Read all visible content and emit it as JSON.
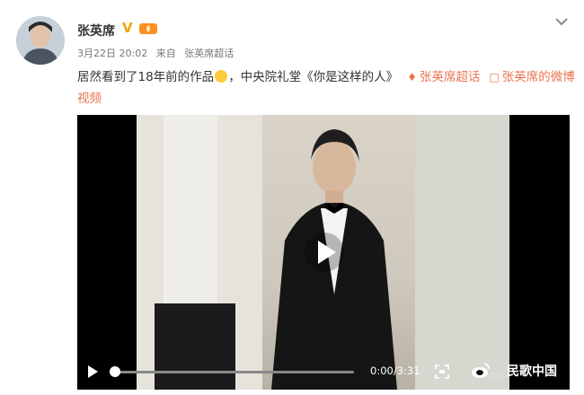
{
  "author": {
    "name": "张英席",
    "verified_badge": "V"
  },
  "meta": {
    "date": "3月22日 20:02",
    "from_label": "来自",
    "source": "张英席超话"
  },
  "post": {
    "text_part1": "居然看到了18年前的作品",
    "text_part2": "，中央院礼堂《你是这样的人》",
    "link1_label": "张英席超话",
    "link2_label": "张英席的微博视频"
  },
  "video": {
    "time": "0:00/3:31",
    "progress": 0.0,
    "watermark": "民歌中国",
    "watermark_small": "微博"
  },
  "colors": {
    "link": "#eb7350",
    "badge": "#f2a400",
    "emoji": "#ffc93c"
  },
  "icons": {
    "avatar": "avatar",
    "level": "level-flame-icon",
    "more": "chevron-down-icon",
    "supertopic": "diamond-icon",
    "video_link": "video-icon",
    "play_overlay": "play-circle-icon",
    "play": "play-icon",
    "fullscreen": "fullscreen-icon",
    "watermark": "weibo-logo-icon"
  }
}
